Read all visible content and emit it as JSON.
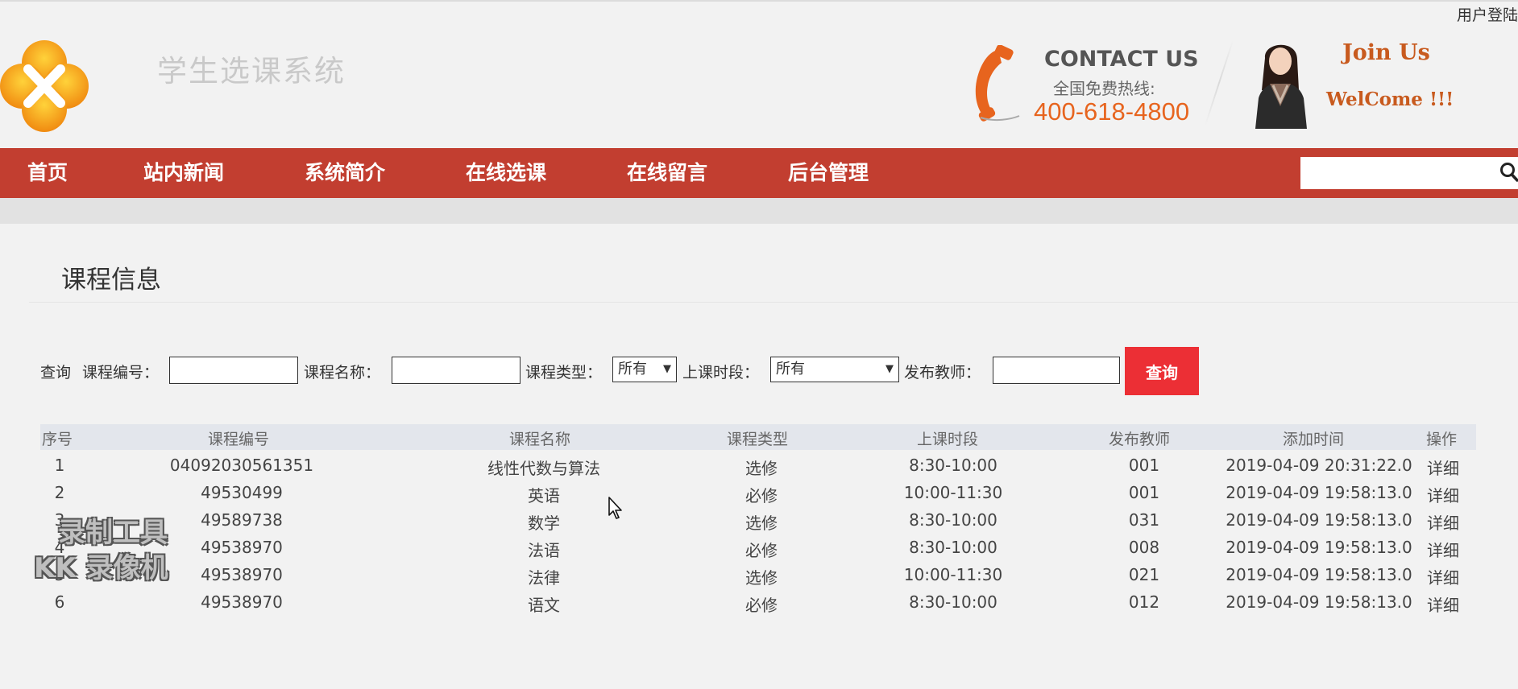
{
  "header": {
    "user_login": "用户登陆",
    "site_title": "学生选课系统",
    "contact_title": "CONTACT US",
    "contact_subtitle": "全国免费热线:",
    "contact_phone": "400-618-4800",
    "join_us": "Join Us",
    "welcome": "WelCome !!!"
  },
  "nav": {
    "items": [
      "首页",
      "站内新闻",
      "系统简介",
      "在线选课",
      "在线留言",
      "后台管理"
    ],
    "search_icon": "search-icon"
  },
  "page": {
    "heading": "课程信息"
  },
  "query": {
    "label_prefix": "查询",
    "course_code_label": "课程编号：",
    "course_name_label": "课程名称：",
    "course_type_label": "课程类型：",
    "course_type_value": "所有",
    "time_slot_label": "上课时段：",
    "time_slot_value": "所有",
    "teacher_label": "发布教师：",
    "button_label": "查询"
  },
  "table": {
    "headers": [
      "序号",
      "课程编号",
      "课程名称",
      "课程类型",
      "上课时段",
      "发布教师",
      "添加时间",
      "操作"
    ],
    "rows": [
      [
        "1",
        "04092030561351",
        "线性代数与算法",
        "选修",
        "8:30-10:00",
        "001",
        "2019-04-09 20:31:22.0",
        "详细"
      ],
      [
        "2",
        "49530499",
        "英语",
        "必修",
        "10:00-11:30",
        "001",
        "2019-04-09 19:58:13.0",
        "详细"
      ],
      [
        "3",
        "49589738",
        "数学",
        "选修",
        "8:30-10:00",
        "031",
        "2019-04-09 19:58:13.0",
        "详细"
      ],
      [
        "4",
        "49538970",
        "法语",
        "必修",
        "8:30-10:00",
        "008",
        "2019-04-09 19:58:13.0",
        "详细"
      ],
      [
        "5",
        "49538970",
        "法律",
        "选修",
        "10:00-11:30",
        "021",
        "2019-04-09 19:58:13.0",
        "详细"
      ],
      [
        "6",
        "49538970",
        "语文",
        "必修",
        "8:30-10:00",
        "012",
        "2019-04-09 19:58:13.0",
        "详细"
      ]
    ]
  },
  "watermark": {
    "line1": "录制工具",
    "line2": "KK 录像机"
  },
  "colors": {
    "nav_bg": "#c23e30",
    "query_button": "#ec2f35",
    "phone_orange": "#e7641e"
  }
}
